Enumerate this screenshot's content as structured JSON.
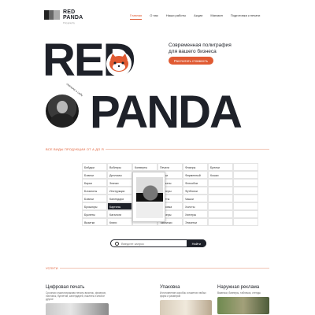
{
  "header": {
    "logo_line1": "RED",
    "logo_line2": "PANDA",
    "logo_sub": "Polygraphy",
    "nav": [
      "Главная",
      "О нас",
      "Наши работы",
      "Акции",
      "Магазин",
      "Подготовка к печати"
    ]
  },
  "hero": {
    "word1": "RED",
    "word2": "PANDA",
    "title": "Современная полиграфия для вашего бизнеса",
    "cta": "Рассчитать стоимость",
    "ring_text": "сначала о себе"
  },
  "catalog": {
    "label": "ВСЕ ВИДЫ ПРОДУКЦИИ ОТ А ДО Я",
    "rows": [
      [
        "Бейджи",
        "Воблеры",
        "Конверты",
        "Печати",
        "Флаеры",
        "Брелки",
        ""
      ],
      [
        "Бланки",
        "Дипломы",
        "Листовки",
        "Папки",
        "Фирменный",
        "Кошки",
        ""
      ],
      [
        "Бирки",
        "Значки",
        "",
        "Плакаты",
        "Фотообои",
        "",
        ""
      ],
      [
        "Блокноты",
        "Инструкции",
        "",
        "Постеры",
        "Футболки",
        "",
        ""
      ],
      [
        "Бланки",
        "Календари",
        "",
        "Пакеты",
        "Чашки",
        "",
        ""
      ],
      [
        "Брошюры",
        "Картины",
        "",
        "Упаковка",
        "Холсты",
        "",
        ""
      ],
      [
        "Буклеты",
        "Каталоги",
        "",
        "Стикеры",
        "Хэнгеры",
        "",
        ""
      ],
      [
        "Визитки",
        "Книги",
        "",
        "Таблички",
        "Этикетки",
        "",
        ""
      ]
    ],
    "selected": "Картины"
  },
  "search": {
    "placeholder": "Введите запрос",
    "button": "Найти"
  },
  "services": {
    "label": "УСЛУГИ",
    "cards": [
      {
        "title": "Цифровая печать",
        "desc": "Срочная и малотиражная печать визиток, флаеров, листовок, буклетов, календарей, наклеек и многое другое"
      },
      {
        "title": "Упаковка",
        "desc": "Изготовление коробок и пакетов любых форм и размеров"
      },
      {
        "title": "Наружная реклама",
        "desc": "Вывески, баннеры, таблички, стенды"
      }
    ]
  },
  "colors": {
    "accent": "#e05a32",
    "dark": "#1e2129"
  }
}
